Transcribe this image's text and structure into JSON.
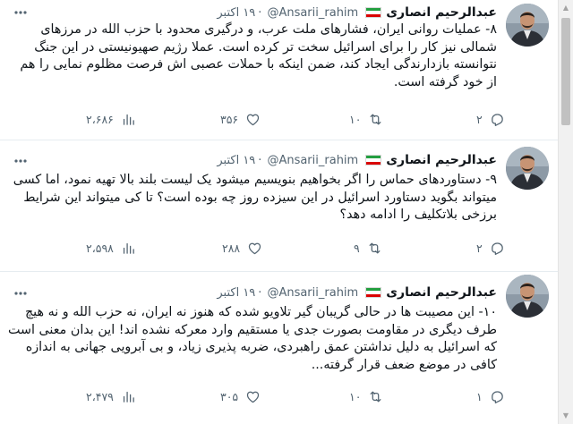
{
  "flag_colors": [
    "#239f40",
    "#ffffff",
    "#da0000"
  ],
  "icons": {
    "reply": "reply-icon",
    "retweet": "retweet-icon",
    "like": "like-icon",
    "views": "views-icon",
    "more": "more-icon",
    "flag": "iran-flag-icon"
  },
  "tweets": [
    {
      "name": "عبدالرحیم انصاری",
      "handle": "@Ansarii_rahim",
      "separator": "·",
      "time": "۱۹ اکتبر",
      "text": "۸- عملیات روانی ایران، فشارهای ملت عرب، و درگیری محدود با حزب الله در مرزهای شمالی نیز کار را برای اسرائیل سخت تر کرده است. عملا رژیم صهیونیستی در این جنگ نتوانسته بازدارندگی ایجاد کند، ضمن اینکه با حملات عصبی اش فرصت مظلوم نمایی را هم از خود گرفته است.",
      "replies": "۲",
      "retweets": "۱۰",
      "likes": "۳۵۶",
      "views": "۲،۶۸۶"
    },
    {
      "name": "عبدالرحیم انصاری",
      "handle": "@Ansarii_rahim",
      "separator": "·",
      "time": "۱۹ اکتبر",
      "text": "۹- دستاوردهای حماس را اگر بخواهیم بنویسیم میشود یک لیست بلند بالا تهیه نمود، اما کسی میتواند بگوید دستاورد اسرائیل در این سیزده روز چه بوده است؟ تا کی میتواند این شرایط برزخی بلاتکلیف را ادامه دهد؟",
      "replies": "۲",
      "retweets": "۹",
      "likes": "۲۸۸",
      "views": "۲،۵۹۸"
    },
    {
      "name": "عبدالرحیم انصاری",
      "handle": "@Ansarii_rahim",
      "separator": "·",
      "time": "۱۹ اکتبر",
      "text": "۱۰- این مصیبت ها در حالی گریبان گیر تلاویو شده که هنوز نه ایران، نه حزب الله و نه هیچ طرف دیگری در مقاومت بصورت جدی یا مستقیم وارد معرکه نشده اند! این بدان معنی است که اسرائیل به دلیل نداشتن عمق راهبردی، ضربه پذیری زیاد، و بی آبرویی جهانی به اندازه کافی در موضع ضعف قرار گرفته...",
      "replies": "۱",
      "retweets": "۱۰",
      "likes": "۳۰۵",
      "views": "۲،۴۷۹"
    }
  ]
}
